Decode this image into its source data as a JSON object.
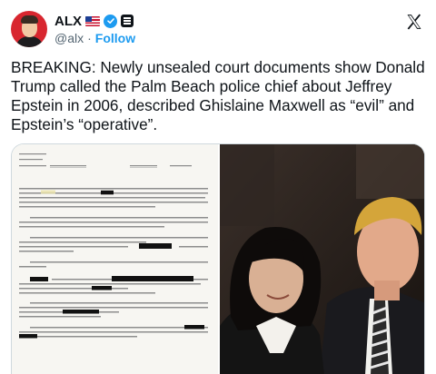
{
  "post": {
    "author": {
      "display_name": "ALX",
      "handle": "@alx",
      "separator": "·",
      "follow_label": "Follow",
      "avatar_icon": "avatar-photo",
      "badges": [
        "us-flag-icon",
        "verified-badge-icon",
        "affiliate-badge-icon"
      ]
    },
    "platform_icon": "x-logo-icon",
    "text": "BREAKING: Newly unsealed court documents show Donald Trump called the Palm Beach police chief about Jeffrey Epstein in 2006, described Ghislaine Maxwell as “evil” and Epstein’s “operative”.",
    "media": [
      {
        "kind": "document-scan",
        "icon": "document-image"
      },
      {
        "kind": "photo",
        "icon": "photo-image"
      }
    ]
  },
  "colors": {
    "text": "#0f1419",
    "secondary": "#536471",
    "accent": "#1d9bf0",
    "avatar_bg": "#d8262f"
  }
}
